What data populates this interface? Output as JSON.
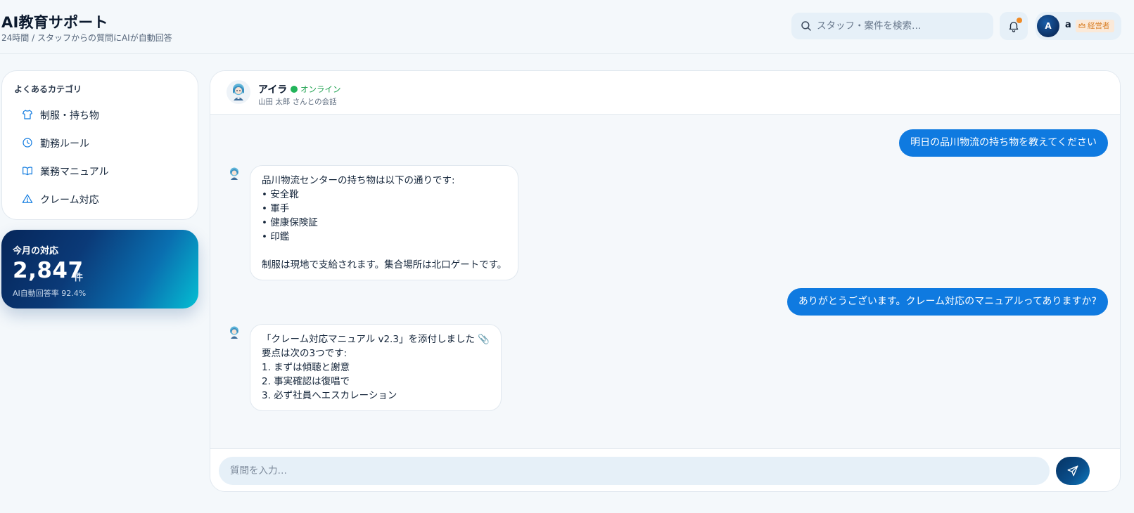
{
  "header": {
    "title": "AI教育サポート",
    "subtitle": "24時間 / スタッフからの質問にAIが自動回答",
    "search": {
      "placeholder": "スタッフ・案件を検索…",
      "value": ""
    },
    "notification": {
      "has_unread": true,
      "dot_color": "#f08a24"
    },
    "user": {
      "avatar_initial": "A",
      "name": "a",
      "role": "経営者"
    }
  },
  "sidebar": {
    "categories_heading": "よくあるカテゴリ",
    "categories": [
      {
        "icon": "shirt-icon",
        "label": "制服・持ち物"
      },
      {
        "icon": "clock-icon",
        "label": "勤務ルール"
      },
      {
        "icon": "book-icon",
        "label": "業務マニュアル"
      },
      {
        "icon": "warning-icon",
        "label": "クレーム対応"
      }
    ],
    "stats": {
      "heading": "今月の対応",
      "count": "2,847",
      "unit": "件",
      "rate": "AI自動回答率 92.4%"
    }
  },
  "chat": {
    "bot_name": "アイラ",
    "status": "オンライン",
    "conversation_with": "山田 太郎 さんとの会話",
    "messages": [
      {
        "from": "user",
        "text": "明日の品川物流の持ち物を教えてください"
      },
      {
        "from": "bot",
        "lines": [
          "品川物流センターの持ち物は以下の通りです:",
          "• 安全靴",
          "• 軍手",
          "• 健康保険証",
          "• 印鑑",
          "",
          "制服は現地で支給されます。集合場所は北口ゲートです。"
        ]
      },
      {
        "from": "user",
        "text": "ありがとうございます。クレーム対応のマニュアルってありますか?"
      },
      {
        "from": "bot",
        "lines": [
          "「クレーム対応マニュアル v2.3」を添付しました 📎",
          "要点は次の3つです:",
          "1. まずは傾聴と謝意",
          "2. 事実確認は復唱で",
          "3. 必ず社員へエスカレーション"
        ]
      }
    ],
    "input": {
      "placeholder": "質問を入力…",
      "value": ""
    }
  },
  "colors": {
    "accent": "#0f7ae0",
    "online": "#22b45a",
    "badge_text": "#d9822b",
    "badge_bg": "#fbe9d8"
  }
}
